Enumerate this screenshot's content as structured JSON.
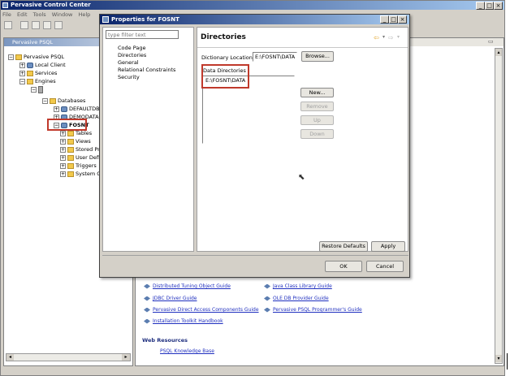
{
  "app": {
    "title": "Pervasive Control Center",
    "menu": [
      "File",
      "Edit",
      "Tools",
      "Window",
      "Help"
    ]
  },
  "left_panel": {
    "title": "Pervasive PSQL",
    "tree": [
      {
        "label": "Pervasive PSQL"
      },
      {
        "label": "Local Client"
      },
      {
        "label": "Services"
      },
      {
        "label": "Engines"
      },
      {
        "label": "Databases"
      },
      {
        "label": "DEFAULTDB"
      },
      {
        "label": "DEMODATA"
      },
      {
        "label": "FOSNT"
      },
      {
        "label": "Tables"
      },
      {
        "label": "Views"
      },
      {
        "label": "Stored Pro"
      },
      {
        "label": "User Defin"
      },
      {
        "label": "Triggers"
      },
      {
        "label": "System Ol"
      }
    ]
  },
  "dialog": {
    "title": "Properties for FOSNT",
    "filter_placeholder": "type filter text",
    "nav": [
      "Code Page",
      "Directories",
      "General",
      "Relational Constraints",
      "Security"
    ],
    "page_title": "Directories",
    "dictionary_label": "Dictionary Location",
    "dictionary_value": "E:\\FOSNT\\DATA",
    "browse_label": "Browse...",
    "data_dirs_label": "Data Directories",
    "data_dirs": [
      "E:\\FOSNT\\DATA"
    ],
    "new_label": "New...",
    "remove_label": "Remove",
    "up_label": "Up",
    "down_label": "Down",
    "restore_label": "Restore Defaults",
    "apply_label": "Apply",
    "ok_label": "OK",
    "cancel_label": "Cancel"
  },
  "main_links": {
    "left": [
      "Distributed Tuning Object Guide",
      "JDBC Driver Guide",
      "Pervasive Direct Access Components Guide",
      "Installation Toolkit Handbook"
    ],
    "right": [
      "Java Class Library Guide",
      "OLE DB Provider Guide",
      "Pervasive PSQL Programmer's Guide"
    ],
    "web_heading": "Web Resources",
    "web_link": "PSQL Knowledge Base"
  }
}
